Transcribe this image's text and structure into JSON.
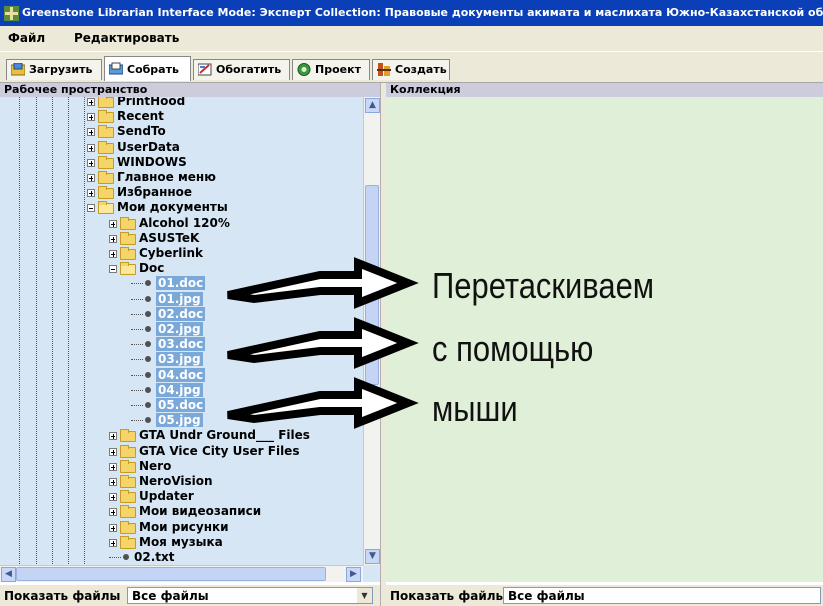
{
  "window": {
    "title": "Greenstone Librarian Interface  Mode: Эксперт  Collection: Правовые документы акимата и маслихата Южно-Казахстанской области"
  },
  "menu": [
    "Файл",
    "Редактировать"
  ],
  "tabs": [
    {
      "label": "Загрузить",
      "icon": "download-icon"
    },
    {
      "label": "Собрать",
      "icon": "gather-icon",
      "active": true
    },
    {
      "label": "Обогатить",
      "icon": "enrich-icon"
    },
    {
      "label": "Проект",
      "icon": "design-icon"
    },
    {
      "label": "Создать",
      "icon": "create-icon"
    }
  ],
  "left_pane": {
    "header": "Рабочее пространство",
    "tree": [
      {
        "label": "PrintHood",
        "level": 1,
        "type": "folder",
        "expanded": false
      },
      {
        "label": "Recent",
        "level": 1,
        "type": "folder",
        "expanded": false
      },
      {
        "label": "SendTo",
        "level": 1,
        "type": "folder",
        "expanded": false
      },
      {
        "label": "UserData",
        "level": 1,
        "type": "folder",
        "expanded": false
      },
      {
        "label": "WINDOWS",
        "level": 1,
        "type": "folder",
        "expanded": false
      },
      {
        "label": "Главное меню",
        "level": 1,
        "type": "folder",
        "expanded": false
      },
      {
        "label": "Избранное",
        "level": 1,
        "type": "folder",
        "expanded": false
      },
      {
        "label": "Мои документы",
        "level": 1,
        "type": "folder",
        "expanded": true
      },
      {
        "label": "Alcohol 120%",
        "level": 2,
        "type": "folder",
        "expanded": false
      },
      {
        "label": "ASUSTeK",
        "level": 2,
        "type": "folder",
        "expanded": false
      },
      {
        "label": "Cyberlink",
        "level": 2,
        "type": "folder",
        "expanded": false
      },
      {
        "label": "Doc",
        "level": 2,
        "type": "folder",
        "expanded": true
      },
      {
        "label": "01.doc",
        "level": 3,
        "type": "file",
        "selected": true
      },
      {
        "label": "01.jpg",
        "level": 3,
        "type": "file",
        "selected": true
      },
      {
        "label": "02.doc",
        "level": 3,
        "type": "file",
        "selected": true
      },
      {
        "label": "02.jpg",
        "level": 3,
        "type": "file",
        "selected": true
      },
      {
        "label": "03.doc",
        "level": 3,
        "type": "file",
        "selected": true
      },
      {
        "label": "03.jpg",
        "level": 3,
        "type": "file",
        "selected": true
      },
      {
        "label": "04.doc",
        "level": 3,
        "type": "file",
        "selected": true
      },
      {
        "label": "04.jpg",
        "level": 3,
        "type": "file",
        "selected": true
      },
      {
        "label": "05.doc",
        "level": 3,
        "type": "file",
        "selected": true
      },
      {
        "label": "05.jpg",
        "level": 3,
        "type": "file",
        "selected": true
      },
      {
        "label": "GTA Undr Ground___ Files",
        "level": 2,
        "type": "folder",
        "expanded": false
      },
      {
        "label": "GTA Vice City User Files",
        "level": 2,
        "type": "folder",
        "expanded": false
      },
      {
        "label": "Nero",
        "level": 2,
        "type": "folder",
        "expanded": false
      },
      {
        "label": "NeroVision",
        "level": 2,
        "type": "folder",
        "expanded": false
      },
      {
        "label": "Updater",
        "level": 2,
        "type": "folder",
        "expanded": false
      },
      {
        "label": "Мои видеозаписи",
        "level": 2,
        "type": "folder",
        "expanded": false
      },
      {
        "label": "Мои рисунки",
        "level": 2,
        "type": "folder",
        "expanded": false
      },
      {
        "label": "Моя музыка",
        "level": 2,
        "type": "folder",
        "expanded": false
      },
      {
        "label": "02.txt",
        "level": 2,
        "type": "file",
        "selected": false
      }
    ],
    "show_files_label": "Показать файлы",
    "filter_value": "Все файлы"
  },
  "right_pane": {
    "header": "Коллекция",
    "show_files_label": "Показать файлы",
    "filter_value": "Все файлы"
  },
  "annotation": {
    "lines": [
      "Перетаскиваем",
      "с помощью",
      "мыши"
    ]
  },
  "colors": {
    "titlebar": "#0a3fb8",
    "workspace_bg": "#d6e6f5",
    "collection_bg": "#e0f0d8",
    "selection_bg": "#7aa8d8"
  }
}
